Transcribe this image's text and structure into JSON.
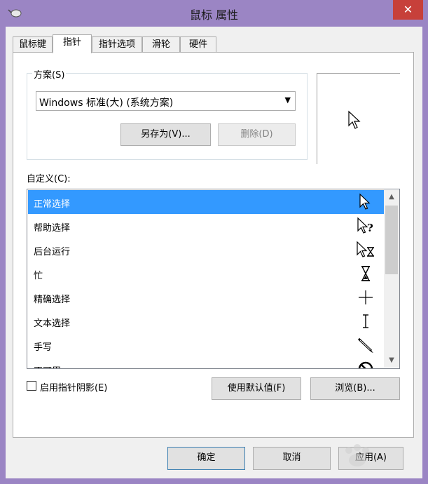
{
  "window": {
    "title": "鼠标 属性",
    "close_glyph": "✕"
  },
  "tabs": [
    {
      "label": "鼠标键"
    },
    {
      "label": "指针"
    },
    {
      "label": "指针选项"
    },
    {
      "label": "滑轮"
    },
    {
      "label": "硬件"
    }
  ],
  "active_tab": "指针",
  "scheme": {
    "label": "方案(S)",
    "selected": "Windows 标准(大) (系统方案)",
    "save_as_label": "另存为(V)...",
    "delete_label": "删除(D)"
  },
  "customize": {
    "label": "自定义(C):",
    "items": [
      {
        "label": "正常选择",
        "icon": "arrow-cursor-icon",
        "selected": true
      },
      {
        "label": "帮助选择",
        "icon": "help-cursor-icon"
      },
      {
        "label": "后台运行",
        "icon": "busy-background-cursor-icon"
      },
      {
        "label": "忙",
        "icon": "hourglass-cursor-icon"
      },
      {
        "label": "精确选择",
        "icon": "crosshair-cursor-icon"
      },
      {
        "label": "文本选择",
        "icon": "ibeam-cursor-icon"
      },
      {
        "label": "手写",
        "icon": "pen-cursor-icon"
      },
      {
        "label": "不可用",
        "icon": "unavailable-cursor-icon"
      }
    ]
  },
  "shadow_checkbox": {
    "label": "启用指针阴影(E)",
    "checked": false
  },
  "use_default_label": "使用默认值(F)",
  "browse_label": "浏览(B)...",
  "footer": {
    "ok_label": "确定",
    "cancel_label": "取消",
    "apply_label": "应用(A)"
  },
  "colors": {
    "title_bar": "#9b85c4",
    "selection": "#3399ff",
    "close_button": "#c7403a"
  }
}
